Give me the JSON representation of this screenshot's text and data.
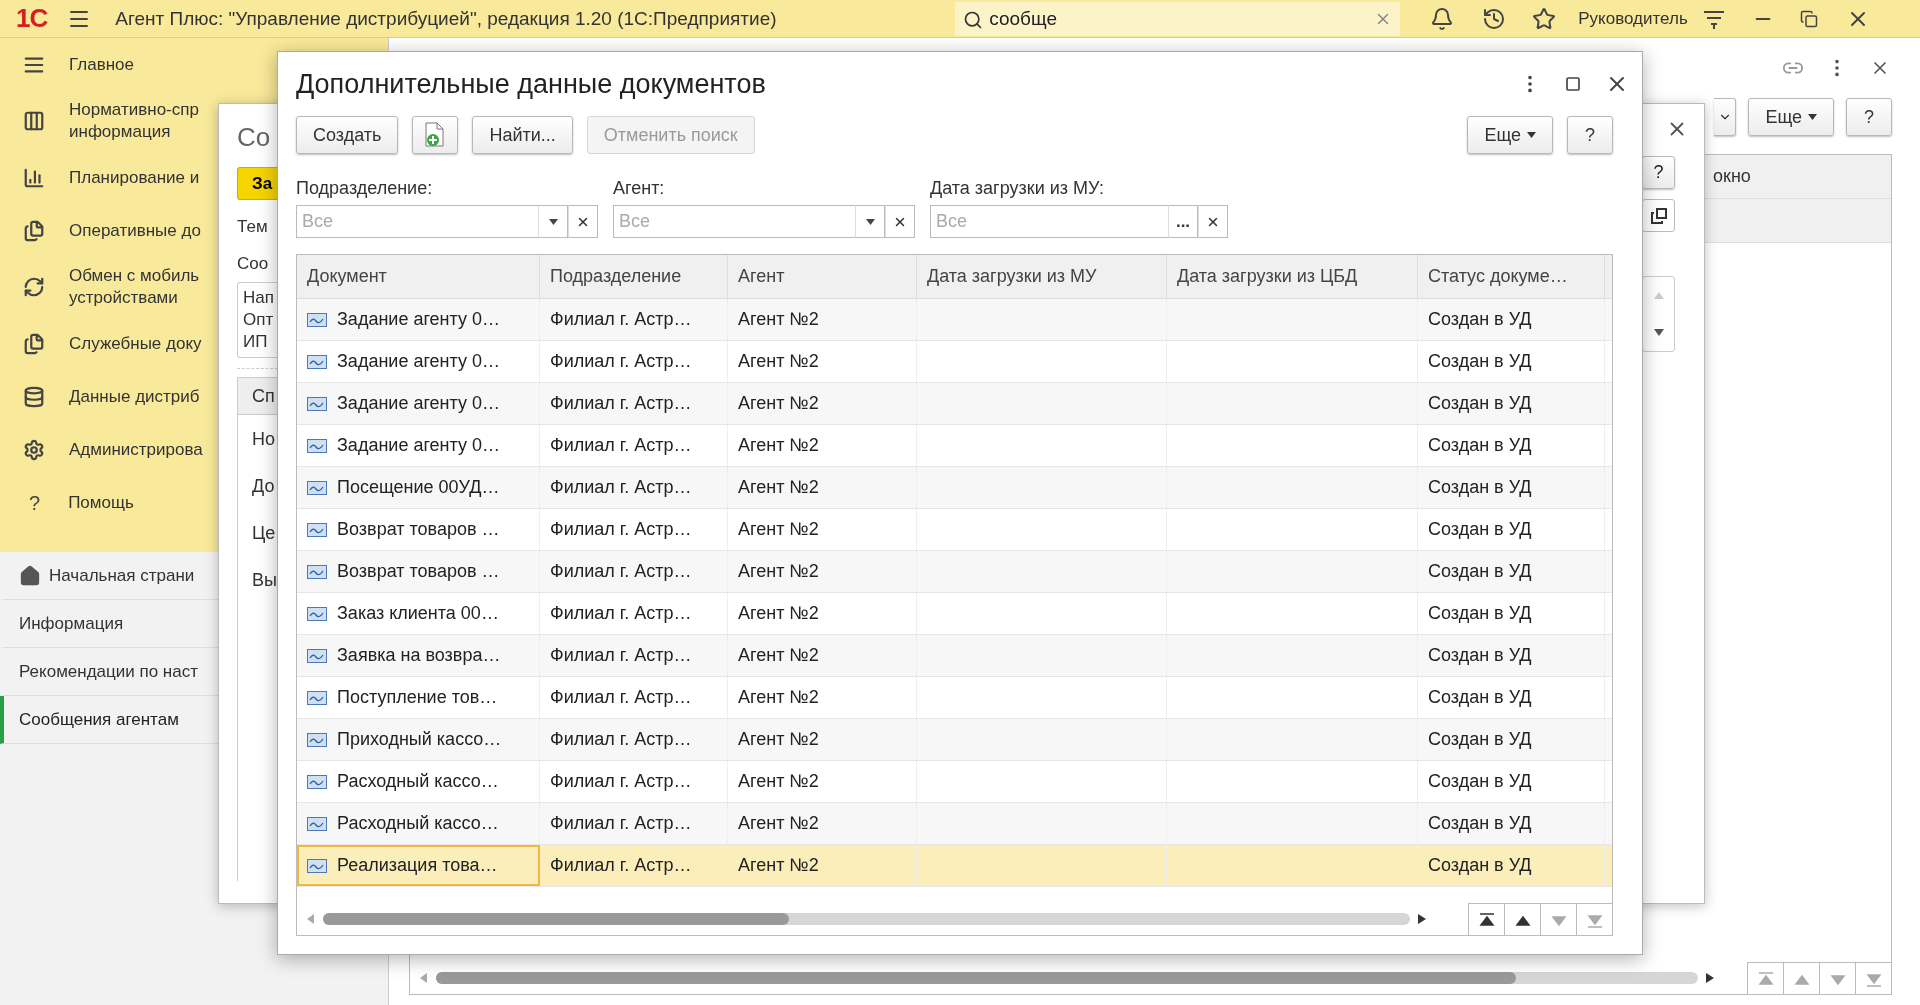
{
  "app_bar": {
    "logo": "1С",
    "title": "Агент Плюс: \"Управление дистрибуцией\", редакция 1.20  (1С:Предприятие)",
    "search": {
      "value": "сообще"
    },
    "user": "Руководитель"
  },
  "sidebar": {
    "sections": [
      {
        "label": "Главное"
      },
      {
        "label": "Нормативно-спр\nинформация"
      },
      {
        "label": "Планирование и"
      },
      {
        "label": "Оперативные до"
      },
      {
        "label": "Обмен с мобиль\nустройствами"
      },
      {
        "label": "Служебные доку"
      },
      {
        "label": "Данные дистриб"
      },
      {
        "label": "Администрирова"
      },
      {
        "label": "Помощь",
        "glyph": "?"
      }
    ],
    "pages": [
      {
        "label": "Начальная страни",
        "selected": false,
        "kind": "home"
      },
      {
        "label": "Информация",
        "selected": false,
        "kind": "plain"
      },
      {
        "label": "Рекомендации по наст",
        "selected": false,
        "kind": "plain"
      },
      {
        "label": "Сообщения агентам",
        "selected": true,
        "kind": "plain"
      }
    ]
  },
  "main": {
    "buttons": [
      {
        "label": "Еще",
        "kind": "menu"
      },
      {
        "label": "?",
        "kind": "plain"
      }
    ],
    "table": {
      "column_1": "окно"
    }
  },
  "back_window": {
    "title": "Со",
    "action_button": "За",
    "labels": [
      "Тем",
      "Соо"
    ],
    "text_lines": [
      "Нап",
      "Опт",
      "ИП"
    ],
    "tab": "Сп",
    "fields": [
      "Но",
      "До",
      "Це",
      "Вы"
    ],
    "help_button": "?"
  },
  "dialog": {
    "title": "Дополнительные данные документов",
    "toolbar": [
      {
        "label": "Создать",
        "kind": "text",
        "disabled": false
      },
      {
        "kind": "add-icon",
        "disabled": false
      },
      {
        "label": "Найти...",
        "kind": "text",
        "disabled": false
      },
      {
        "label": "Отменить поиск",
        "kind": "text",
        "disabled": true
      }
    ],
    "toolbar_right": [
      {
        "label": "Еще",
        "kind": "menu"
      },
      {
        "label": "?",
        "kind": "plain"
      }
    ],
    "filters": [
      {
        "label": "Подразделение:",
        "placeholder": "Все",
        "kind": "dropdown"
      },
      {
        "label": "Агент:",
        "placeholder": "Все",
        "kind": "dropdown"
      },
      {
        "label": "Дата загрузки из МУ:",
        "placeholder": "Все",
        "kind": "picker",
        "picker_button": "..."
      }
    ],
    "table": {
      "columns": [
        "Документ",
        "Подразделение",
        "Агент",
        "Дата загрузки из МУ",
        "Дата загрузки из ЦБД",
        "Статус докуме…"
      ],
      "rows": [
        {
          "document": "Задание агенту 0…",
          "division": "Филиал г. Астр…",
          "agent": "Агент №2",
          "status": "Создан в УД",
          "selected": false
        },
        {
          "document": "Задание агенту 0…",
          "division": "Филиал г. Астр…",
          "agent": "Агент №2",
          "status": "Создан в УД",
          "selected": false
        },
        {
          "document": "Задание агенту 0…",
          "division": "Филиал г. Астр…",
          "agent": "Агент №2",
          "status": "Создан в УД",
          "selected": false
        },
        {
          "document": "Задание агенту 0…",
          "division": "Филиал г. Астр…",
          "agent": "Агент №2",
          "status": "Создан в УД",
          "selected": false
        },
        {
          "document": "Посещение 00УД…",
          "division": "Филиал г. Астр…",
          "agent": "Агент №2",
          "status": "Создан в УД",
          "selected": false
        },
        {
          "document": "Возврат товаров …",
          "division": "Филиал г. Астр…",
          "agent": "Агент №2",
          "status": "Создан в УД",
          "selected": false
        },
        {
          "document": "Возврат товаров …",
          "division": "Филиал г. Астр…",
          "agent": "Агент №2",
          "status": "Создан в УД",
          "selected": false
        },
        {
          "document": "Заказ клиента 00…",
          "division": "Филиал г. Астр…",
          "agent": "Агент №2",
          "status": "Создан в УД",
          "selected": false
        },
        {
          "document": "Заявка на возвра…",
          "division": "Филиал г. Астр…",
          "agent": "Агент №2",
          "status": "Создан в УД",
          "selected": false
        },
        {
          "document": "Поступление тов…",
          "division": "Филиал г. Астр…",
          "agent": "Агент №2",
          "status": "Создан в УД",
          "selected": false
        },
        {
          "document": "Приходный кассо…",
          "division": "Филиал г. Астр…",
          "agent": "Агент №2",
          "status": "Создан в УД",
          "selected": false
        },
        {
          "document": "Расходный кассо…",
          "division": "Филиал г. Астр…",
          "agent": "Агент №2",
          "status": "Создан в УД",
          "selected": false
        },
        {
          "document": "Расходный кассо…",
          "division": "Филиал г. Астр…",
          "agent": "Агент №2",
          "status": "Создан в УД",
          "selected": false
        },
        {
          "document": "Реализация това…",
          "division": "Филиал г. Астр…",
          "agent": "Агент №2",
          "status": "Создан в УД",
          "selected": true
        }
      ]
    }
  }
}
